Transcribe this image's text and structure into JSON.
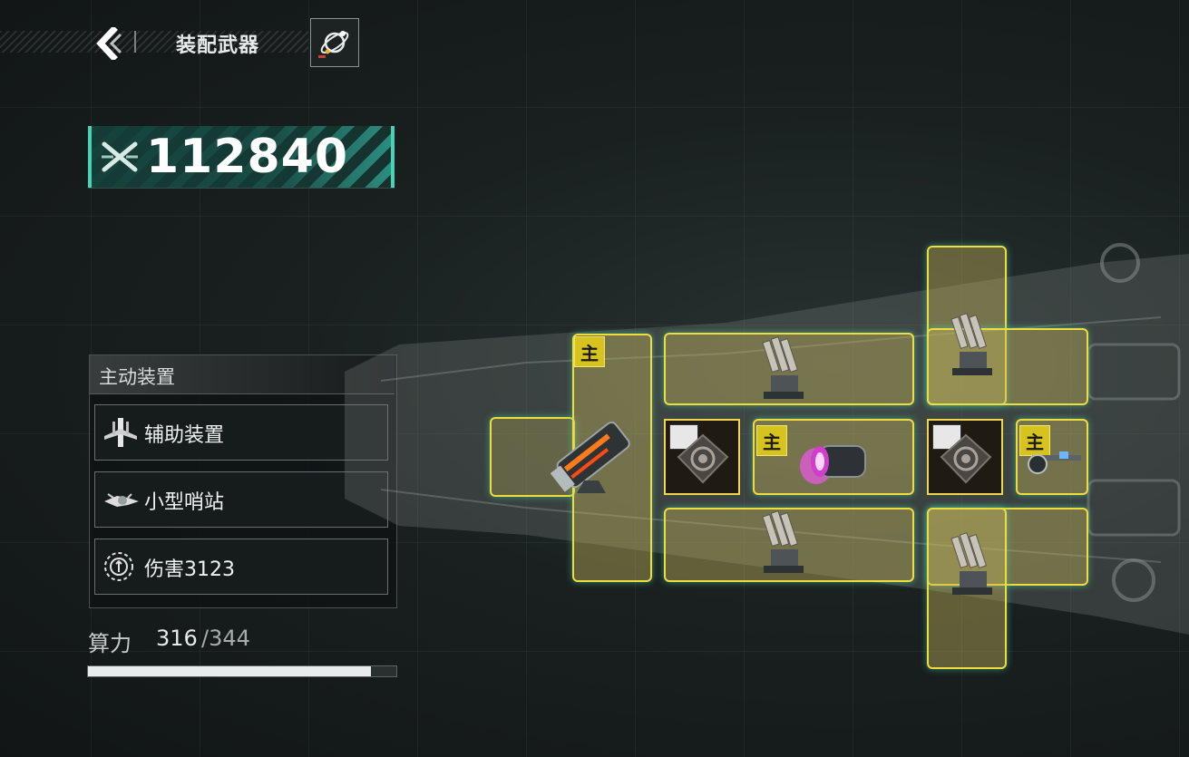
{
  "header": {
    "title": "装配武器",
    "back_icon": "chevron-left-icon",
    "planet_icon": "planet-icon"
  },
  "power": {
    "value": "112840",
    "icon": "crossed-swords-icon"
  },
  "panel": {
    "title": "主动装置",
    "items": [
      {
        "label": "辅助装置",
        "icon": "auxiliary-device-icon"
      },
      {
        "label": "小型哨站",
        "icon": "small-outpost-icon"
      },
      {
        "label": "伤害3123",
        "icon": "damage-target-icon"
      }
    ]
  },
  "compute": {
    "label": "算力",
    "used": "316",
    "total": "/344",
    "fraction": 0.9186
  },
  "slots": {
    "main_badge": "主"
  },
  "colors": {
    "accent": "#3fd7b8",
    "slot_border": "#eedd3a",
    "slot_glow": "#46dcaa",
    "main_badge": "#d7c320"
  }
}
